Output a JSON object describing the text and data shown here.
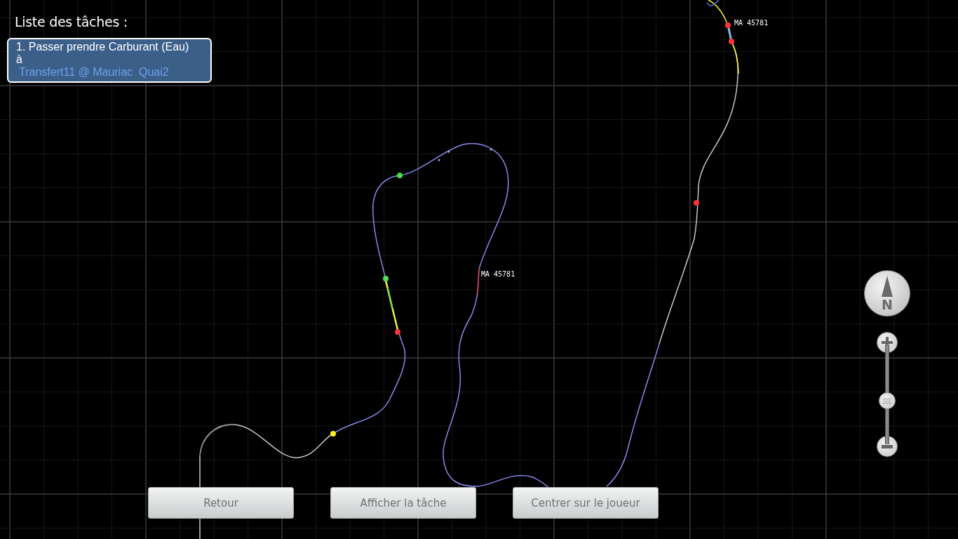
{
  "task_list": {
    "title": "Liste des tâches :",
    "tasks": [
      {
        "text": "1. Passer prendre Carburant (Eau)",
        "preposition": "à",
        "location": "Transfert11 @ Mauriac  Quai2"
      }
    ]
  },
  "map": {
    "train_labels": [
      "MA 45781",
      "MA 45781"
    ]
  },
  "compass": {
    "label": "N"
  },
  "zoom": {
    "level": 0.42
  },
  "buttons": [
    "Retour",
    "Afficher la tâche",
    "Centrer sur le joueur"
  ]
}
